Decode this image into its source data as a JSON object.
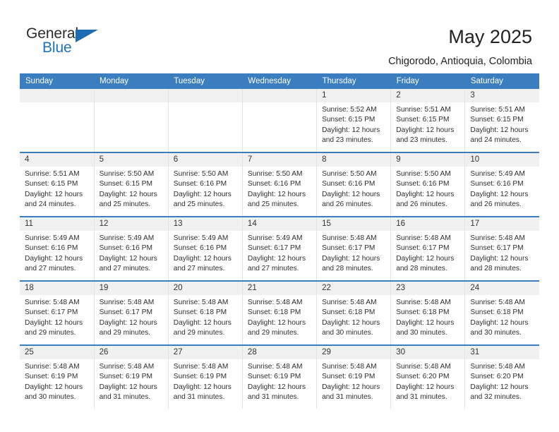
{
  "brand": {
    "name_top": "General",
    "name_bottom": "Blue",
    "logo_icon": "triangle-icon",
    "accent_color": "#1d72bf"
  },
  "header": {
    "title": "May 2025",
    "subtitle": "Chigorodo, Antioquia, Colombia"
  },
  "calendar": {
    "header_bg": "#3a7ebf",
    "daynum_bg": "#f0f0f0",
    "weekday_headers": [
      "Sunday",
      "Monday",
      "Tuesday",
      "Wednesday",
      "Thursday",
      "Friday",
      "Saturday"
    ],
    "weeks": [
      [
        {
          "day": "",
          "sunrise": "",
          "sunset": "",
          "daylight_1": "",
          "daylight_2": "",
          "empty": true
        },
        {
          "day": "",
          "sunrise": "",
          "sunset": "",
          "daylight_1": "",
          "daylight_2": "",
          "empty": true
        },
        {
          "day": "",
          "sunrise": "",
          "sunset": "",
          "daylight_1": "",
          "daylight_2": "",
          "empty": true
        },
        {
          "day": "",
          "sunrise": "",
          "sunset": "",
          "daylight_1": "",
          "daylight_2": "",
          "empty": true
        },
        {
          "day": "1",
          "sunrise": "Sunrise: 5:52 AM",
          "sunset": "Sunset: 6:15 PM",
          "daylight_1": "Daylight: 12 hours",
          "daylight_2": "and 23 minutes."
        },
        {
          "day": "2",
          "sunrise": "Sunrise: 5:51 AM",
          "sunset": "Sunset: 6:15 PM",
          "daylight_1": "Daylight: 12 hours",
          "daylight_2": "and 23 minutes."
        },
        {
          "day": "3",
          "sunrise": "Sunrise: 5:51 AM",
          "sunset": "Sunset: 6:15 PM",
          "daylight_1": "Daylight: 12 hours",
          "daylight_2": "and 24 minutes."
        }
      ],
      [
        {
          "day": "4",
          "sunrise": "Sunrise: 5:51 AM",
          "sunset": "Sunset: 6:15 PM",
          "daylight_1": "Daylight: 12 hours",
          "daylight_2": "and 24 minutes."
        },
        {
          "day": "5",
          "sunrise": "Sunrise: 5:50 AM",
          "sunset": "Sunset: 6:15 PM",
          "daylight_1": "Daylight: 12 hours",
          "daylight_2": "and 25 minutes."
        },
        {
          "day": "6",
          "sunrise": "Sunrise: 5:50 AM",
          "sunset": "Sunset: 6:16 PM",
          "daylight_1": "Daylight: 12 hours",
          "daylight_2": "and 25 minutes."
        },
        {
          "day": "7",
          "sunrise": "Sunrise: 5:50 AM",
          "sunset": "Sunset: 6:16 PM",
          "daylight_1": "Daylight: 12 hours",
          "daylight_2": "and 25 minutes."
        },
        {
          "day": "8",
          "sunrise": "Sunrise: 5:50 AM",
          "sunset": "Sunset: 6:16 PM",
          "daylight_1": "Daylight: 12 hours",
          "daylight_2": "and 26 minutes."
        },
        {
          "day": "9",
          "sunrise": "Sunrise: 5:50 AM",
          "sunset": "Sunset: 6:16 PM",
          "daylight_1": "Daylight: 12 hours",
          "daylight_2": "and 26 minutes."
        },
        {
          "day": "10",
          "sunrise": "Sunrise: 5:49 AM",
          "sunset": "Sunset: 6:16 PM",
          "daylight_1": "Daylight: 12 hours",
          "daylight_2": "and 26 minutes."
        }
      ],
      [
        {
          "day": "11",
          "sunrise": "Sunrise: 5:49 AM",
          "sunset": "Sunset: 6:16 PM",
          "daylight_1": "Daylight: 12 hours",
          "daylight_2": "and 27 minutes."
        },
        {
          "day": "12",
          "sunrise": "Sunrise: 5:49 AM",
          "sunset": "Sunset: 6:16 PM",
          "daylight_1": "Daylight: 12 hours",
          "daylight_2": "and 27 minutes."
        },
        {
          "day": "13",
          "sunrise": "Sunrise: 5:49 AM",
          "sunset": "Sunset: 6:16 PM",
          "daylight_1": "Daylight: 12 hours",
          "daylight_2": "and 27 minutes."
        },
        {
          "day": "14",
          "sunrise": "Sunrise: 5:49 AM",
          "sunset": "Sunset: 6:17 PM",
          "daylight_1": "Daylight: 12 hours",
          "daylight_2": "and 27 minutes."
        },
        {
          "day": "15",
          "sunrise": "Sunrise: 5:48 AM",
          "sunset": "Sunset: 6:17 PM",
          "daylight_1": "Daylight: 12 hours",
          "daylight_2": "and 28 minutes."
        },
        {
          "day": "16",
          "sunrise": "Sunrise: 5:48 AM",
          "sunset": "Sunset: 6:17 PM",
          "daylight_1": "Daylight: 12 hours",
          "daylight_2": "and 28 minutes."
        },
        {
          "day": "17",
          "sunrise": "Sunrise: 5:48 AM",
          "sunset": "Sunset: 6:17 PM",
          "daylight_1": "Daylight: 12 hours",
          "daylight_2": "and 28 minutes."
        }
      ],
      [
        {
          "day": "18",
          "sunrise": "Sunrise: 5:48 AM",
          "sunset": "Sunset: 6:17 PM",
          "daylight_1": "Daylight: 12 hours",
          "daylight_2": "and 29 minutes."
        },
        {
          "day": "19",
          "sunrise": "Sunrise: 5:48 AM",
          "sunset": "Sunset: 6:17 PM",
          "daylight_1": "Daylight: 12 hours",
          "daylight_2": "and 29 minutes."
        },
        {
          "day": "20",
          "sunrise": "Sunrise: 5:48 AM",
          "sunset": "Sunset: 6:18 PM",
          "daylight_1": "Daylight: 12 hours",
          "daylight_2": "and 29 minutes."
        },
        {
          "day": "21",
          "sunrise": "Sunrise: 5:48 AM",
          "sunset": "Sunset: 6:18 PM",
          "daylight_1": "Daylight: 12 hours",
          "daylight_2": "and 29 minutes."
        },
        {
          "day": "22",
          "sunrise": "Sunrise: 5:48 AM",
          "sunset": "Sunset: 6:18 PM",
          "daylight_1": "Daylight: 12 hours",
          "daylight_2": "and 30 minutes."
        },
        {
          "day": "23",
          "sunrise": "Sunrise: 5:48 AM",
          "sunset": "Sunset: 6:18 PM",
          "daylight_1": "Daylight: 12 hours",
          "daylight_2": "and 30 minutes."
        },
        {
          "day": "24",
          "sunrise": "Sunrise: 5:48 AM",
          "sunset": "Sunset: 6:18 PM",
          "daylight_1": "Daylight: 12 hours",
          "daylight_2": "and 30 minutes."
        }
      ],
      [
        {
          "day": "25",
          "sunrise": "Sunrise: 5:48 AM",
          "sunset": "Sunset: 6:19 PM",
          "daylight_1": "Daylight: 12 hours",
          "daylight_2": "and 30 minutes."
        },
        {
          "day": "26",
          "sunrise": "Sunrise: 5:48 AM",
          "sunset": "Sunset: 6:19 PM",
          "daylight_1": "Daylight: 12 hours",
          "daylight_2": "and 31 minutes."
        },
        {
          "day": "27",
          "sunrise": "Sunrise: 5:48 AM",
          "sunset": "Sunset: 6:19 PM",
          "daylight_1": "Daylight: 12 hours",
          "daylight_2": "and 31 minutes."
        },
        {
          "day": "28",
          "sunrise": "Sunrise: 5:48 AM",
          "sunset": "Sunset: 6:19 PM",
          "daylight_1": "Daylight: 12 hours",
          "daylight_2": "and 31 minutes."
        },
        {
          "day": "29",
          "sunrise": "Sunrise: 5:48 AM",
          "sunset": "Sunset: 6:19 PM",
          "daylight_1": "Daylight: 12 hours",
          "daylight_2": "and 31 minutes."
        },
        {
          "day": "30",
          "sunrise": "Sunrise: 5:48 AM",
          "sunset": "Sunset: 6:20 PM",
          "daylight_1": "Daylight: 12 hours",
          "daylight_2": "and 31 minutes."
        },
        {
          "day": "31",
          "sunrise": "Sunrise: 5:48 AM",
          "sunset": "Sunset: 6:20 PM",
          "daylight_1": "Daylight: 12 hours",
          "daylight_2": "and 32 minutes."
        }
      ]
    ]
  }
}
